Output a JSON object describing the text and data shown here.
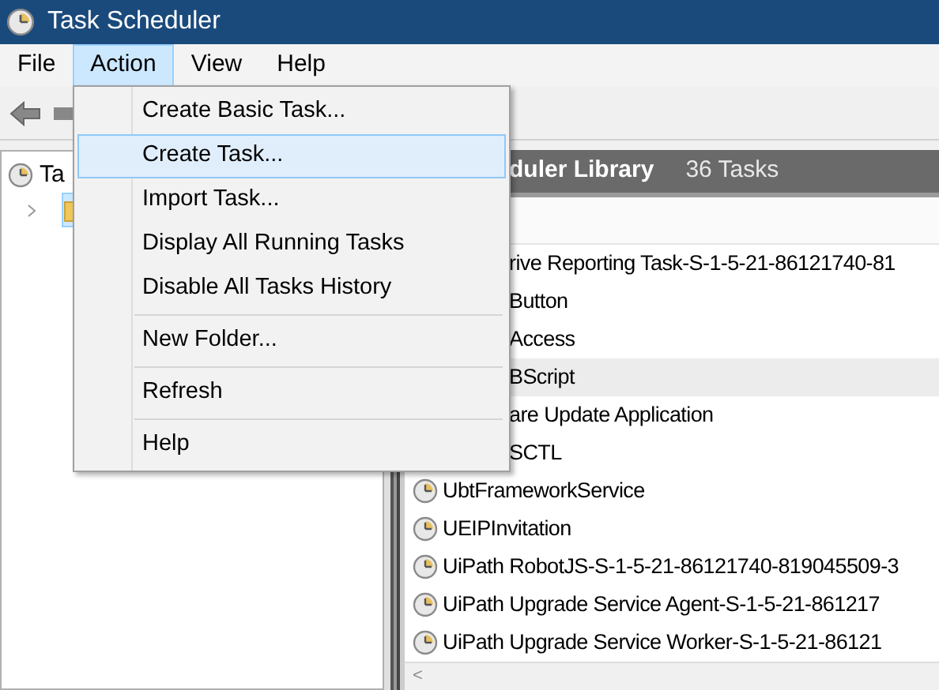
{
  "window": {
    "title": "Task Scheduler"
  },
  "menu_bar": [
    {
      "label": "File",
      "selected": false
    },
    {
      "label": "Action",
      "selected": true
    },
    {
      "label": "View",
      "selected": false
    },
    {
      "label": "Help",
      "selected": false
    }
  ],
  "action_menu": [
    {
      "kind": "item",
      "label": "Create Basic Task...",
      "selected": false
    },
    {
      "kind": "item",
      "label": "Create Task...",
      "selected": true
    },
    {
      "kind": "item",
      "label": "Import Task...",
      "selected": false
    },
    {
      "kind": "item",
      "label": "Display All Running Tasks",
      "selected": false
    },
    {
      "kind": "item",
      "label": "Disable All Tasks History",
      "selected": false
    },
    {
      "kind": "separator"
    },
    {
      "kind": "item",
      "label": "New Folder...",
      "selected": false
    },
    {
      "kind": "separator"
    },
    {
      "kind": "item",
      "label": "Refresh",
      "selected": false
    },
    {
      "kind": "separator"
    },
    {
      "kind": "item",
      "label": "Help",
      "selected": false
    }
  ],
  "tree": [
    {
      "label": "Ta",
      "kind": "clock",
      "selected": false,
      "children": [
        {
          "kind": "folder",
          "selected": true,
          "expanded": false
        }
      ]
    }
  ],
  "panel_header": {
    "title": "duler Library",
    "count": "36 Tasks"
  },
  "tasks": [
    {
      "kind": "covered",
      "name": "rive Reporting Task-S-1-5-21-86121740-81",
      "selected": false
    },
    {
      "kind": "covered",
      "name": "Button",
      "selected": false
    },
    {
      "kind": "covered",
      "name": "Access",
      "selected": false
    },
    {
      "kind": "covered",
      "name": "BScript",
      "selected": true
    },
    {
      "kind": "covered",
      "name": "are Update Application",
      "selected": false
    },
    {
      "kind": "covered",
      "name": "SCTL",
      "selected": false
    },
    {
      "kind": "task",
      "name": "UbtFrameworkService",
      "selected": false
    },
    {
      "kind": "task",
      "name": "UEIPInvitation",
      "selected": false
    },
    {
      "kind": "task",
      "name": "UiPath RobotJS-S-1-5-21-86121740-819045509-3",
      "selected": false
    },
    {
      "kind": "task",
      "name": "UiPath Upgrade Service Agent-S-1-5-21-861217",
      "selected": false
    },
    {
      "kind": "task",
      "name": "UiPath Upgrade Service Worker-S-1-5-21-86121",
      "selected": false
    }
  ],
  "scrollbar": {
    "left_arrow": "<"
  }
}
